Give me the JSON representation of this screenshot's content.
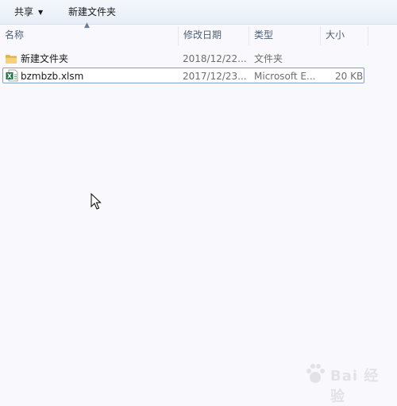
{
  "toolbar": {
    "share_label": "共享",
    "new_folder_label": "新建文件夹"
  },
  "columns": {
    "name": "名称",
    "modified": "修改日期",
    "type": "类型",
    "size": "大小"
  },
  "files": [
    {
      "name": "新建文件夹",
      "modified": "2018/12/22...",
      "type": "文件夹",
      "size": "",
      "icon": "folder-icon"
    },
    {
      "name": "bzmbzb.xlsm",
      "modified": "2017/12/23...",
      "type": "Microsoft E...",
      "size": "20 KB",
      "icon": "excel-file-icon",
      "selected": true
    }
  ],
  "watermark": {
    "text": "Bai 经验"
  },
  "colors": {
    "selection_border": "#7da2ce",
    "toolbar_bg": "#e8eef7",
    "header_text": "#4c607a"
  }
}
